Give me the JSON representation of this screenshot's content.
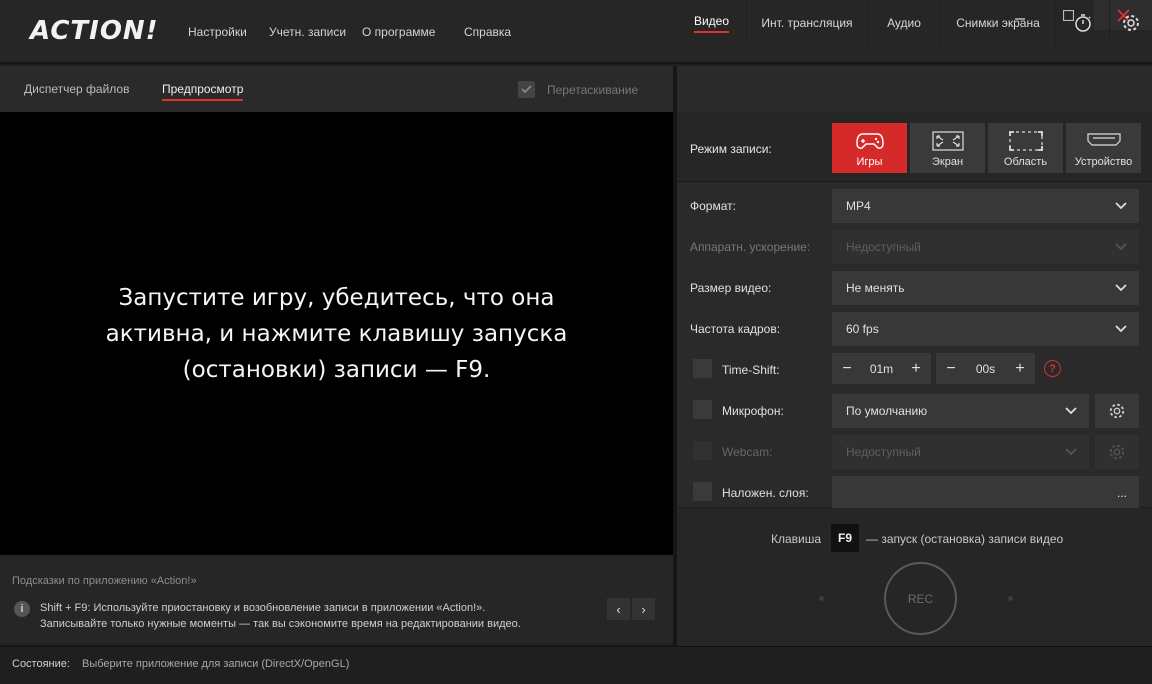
{
  "app": {
    "logo": "ACTION!"
  },
  "menu": [
    "Настройки",
    "Учетн. записи",
    "О программе",
    "Справка"
  ],
  "window_controls": {
    "minimize": "—",
    "maximize": "□",
    "close": "✕"
  },
  "left_tabs": {
    "files": "Диспетчер файлов",
    "preview": "Предпросмотр",
    "drag_label": "Перетаскивание",
    "drag_checked": true
  },
  "preview": {
    "message": "Запустите игру, убедитесь, что она активна, и нажмите клавишу запуска (остановки) записи — F9."
  },
  "tips": {
    "title": "Подсказки по приложению «Action!»",
    "info_icon": "i",
    "line1": "Shift + F9: Используйте приостановку и возобновление записи в приложении «Action!».",
    "line2": "Записывайте только нужные моменты — так вы сэкономите время на редактировании видео.",
    "prev": "‹",
    "next": "›"
  },
  "status": {
    "label": "Состояние:",
    "text": "Выберите приложение для записи (DirectX/OpenGL)"
  },
  "right_tabs": {
    "video": "Видео",
    "stream": "Инт. трансляция",
    "audio": "Аудио",
    "screenshots": "Снимки экрана"
  },
  "record_mode": {
    "label": "Режим записи:",
    "modes": [
      "Игры",
      "Экран",
      "Область",
      "Устройство"
    ],
    "active": "Игры"
  },
  "settings": {
    "format": {
      "label": "Формат:",
      "value": "MP4"
    },
    "hw_accel": {
      "label": "Аппаратн. ускорение:",
      "value": "Недоступный"
    },
    "video_size": {
      "label": "Размер видео:",
      "value": "Не менять"
    },
    "fps": {
      "label": "Частота кадров:",
      "value": "60 fps"
    },
    "timeshift": {
      "label": "Time-Shift:",
      "minutes": "01m",
      "seconds": "00s",
      "minus": "−",
      "plus": "+",
      "help": "?"
    },
    "mic": {
      "label": "Микрофон:",
      "value": "По умолчанию"
    },
    "webcam": {
      "label": "Webcam:",
      "value": "Недоступный"
    },
    "overlay": {
      "label": "Наложен. слоя:",
      "more": "..."
    }
  },
  "record": {
    "hotkey_label": "Клавиша",
    "hotkey": "F9",
    "hotkey_desc": "— запуск (остановка) записи видео",
    "rec_label": "REC"
  },
  "colors": {
    "accent": "#d62a2a",
    "background": "#1e1e1e",
    "panel": "#2a2a2a"
  }
}
